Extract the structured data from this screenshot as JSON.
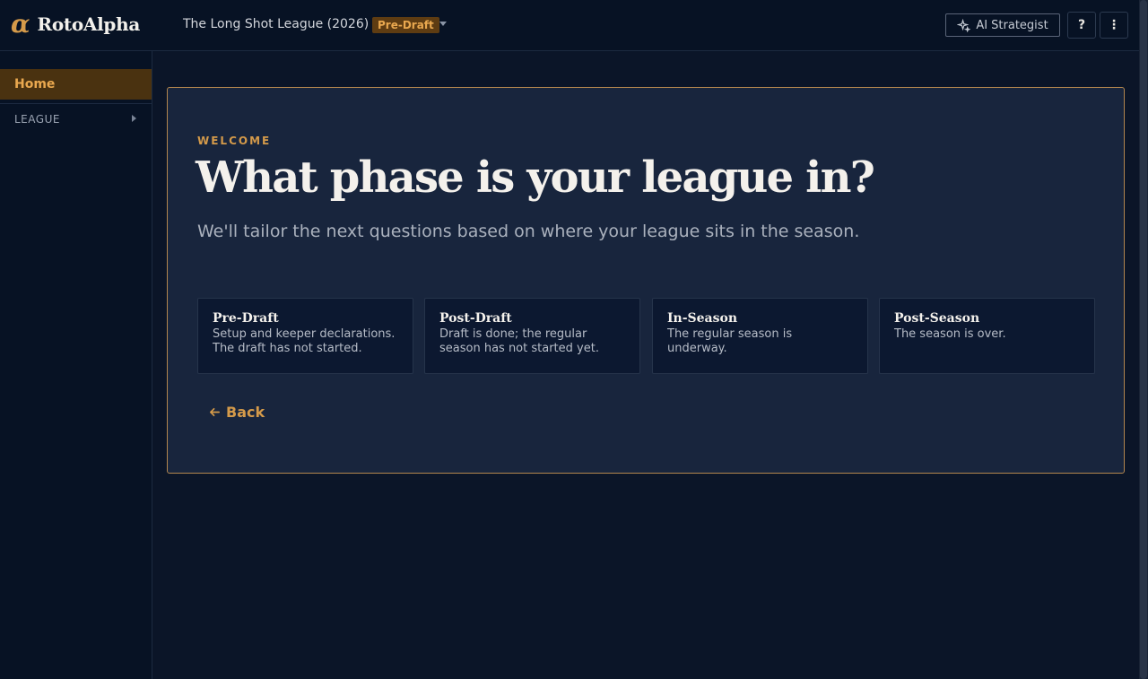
{
  "app": {
    "logo_symbol": "α",
    "name": "RotoAlpha"
  },
  "header": {
    "league_name": "The Long Shot League (2026)",
    "phase_badge": "Pre-Draft",
    "ai_button": "AI Strategist",
    "help_label": "?",
    "more_label": "⋮"
  },
  "sidebar": {
    "home": "Home",
    "league_section": "LEAGUE"
  },
  "main": {
    "eyebrow": "WELCOME",
    "title": "What phase is your league in?",
    "subtitle": "We'll tailor the next questions based on where your league sits in the season.",
    "phases": [
      {
        "title": "Pre-Draft",
        "desc": "Setup and keeper declarations. The draft has not started."
      },
      {
        "title": "Post-Draft",
        "desc": "Draft is done; the regular season has not started yet."
      },
      {
        "title": "In-Season",
        "desc": "The regular season is underway."
      },
      {
        "title": "Post-Season",
        "desc": "The season is over."
      }
    ],
    "back_label": "Back"
  },
  "colors": {
    "accent": "#d49a4a",
    "background": "#0b1528",
    "card": "#18253d",
    "badge_bg": "#5e3c12"
  }
}
